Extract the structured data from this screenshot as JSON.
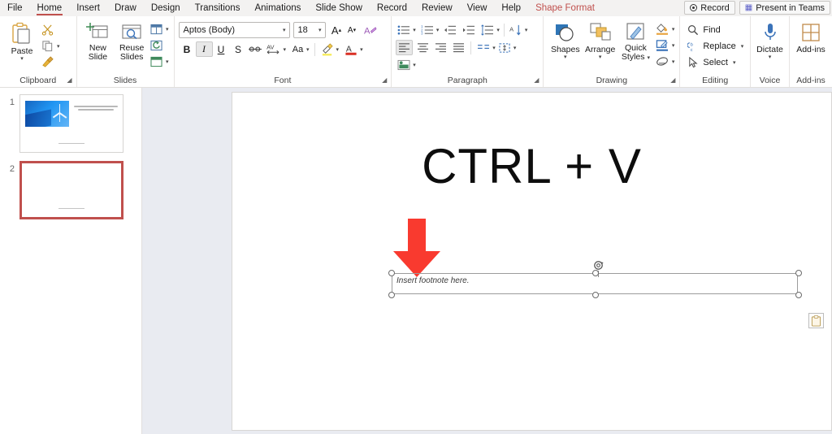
{
  "tabs": [
    {
      "label": "File",
      "state": "normal"
    },
    {
      "label": "Home",
      "state": "active"
    },
    {
      "label": "Insert",
      "state": "normal"
    },
    {
      "label": "Draw",
      "state": "normal"
    },
    {
      "label": "Design",
      "state": "normal"
    },
    {
      "label": "Transitions",
      "state": "normal"
    },
    {
      "label": "Animations",
      "state": "normal"
    },
    {
      "label": "Slide Show",
      "state": "normal"
    },
    {
      "label": "Record",
      "state": "normal"
    },
    {
      "label": "Review",
      "state": "normal"
    },
    {
      "label": "View",
      "state": "normal"
    },
    {
      "label": "Help",
      "state": "normal"
    },
    {
      "label": "Shape Format",
      "state": "contextual"
    }
  ],
  "titlebar_right": {
    "record_label": "Record",
    "present_in_teams_label": "Present in Teams"
  },
  "ribbon": {
    "clipboard": {
      "group_label": "Clipboard",
      "paste_label": "Paste",
      "cut_name": "Cut",
      "copy_name": "Copy",
      "format_painter_name": "Format Painter"
    },
    "slides": {
      "group_label": "Slides",
      "new_slide_label": "New Slide",
      "reuse_slides_label": "Reuse Slides",
      "layout_name": "Layout",
      "reset_name": "Reset",
      "section_name": "Section"
    },
    "font": {
      "group_label": "Font",
      "font_name_value": "Aptos (Body)",
      "font_size_value": "18",
      "grow_font": "A",
      "shrink_font": "A",
      "clear_formatting": "A",
      "bold": "B",
      "italic": "I",
      "underline": "U",
      "strikethrough": "S",
      "shadow_name": "Text Shadow",
      "char_spacing": "AV",
      "change_case": "Aa",
      "highlight_name": "Text Highlight Color",
      "font_color": "A",
      "italic_state": "active"
    },
    "paragraph": {
      "group_label": "Paragraph",
      "bullets_name": "Bullets",
      "numbering_name": "Numbering",
      "decrease_indent_name": "Decrease Indent",
      "increase_indent_name": "Increase Indent",
      "line_spacing_name": "Line Spacing",
      "align_left_name": "Align Left",
      "center_name": "Center",
      "align_right_name": "Align Right",
      "justify_name": "Justify",
      "columns_name": "Columns",
      "text_direction_name": "Text Direction",
      "align_text_name": "Align Text",
      "convert_smartart_name": "Convert to SmartArt",
      "align_left_state": "active"
    },
    "drawing": {
      "group_label": "Drawing",
      "shapes_label": "Shapes",
      "arrange_label": "Arrange",
      "quick_styles_label": "Quick Styles",
      "shape_fill_name": "Shape Fill",
      "shape_outline_name": "Shape Outline",
      "shape_effects_name": "Shape Effects"
    },
    "editing": {
      "group_label": "Editing",
      "find_label": "Find",
      "replace_label": "Replace",
      "select_label": "Select"
    },
    "voice": {
      "group_label": "Voice",
      "dictate_label": "Dictate"
    },
    "addins": {
      "group_label": "Add-ins",
      "addins_label": "Add-ins"
    }
  },
  "thumbnails": [
    {
      "number": "1",
      "state": "normal",
      "has_image": true,
      "image_name": "solar-panels-wind-turbine-photo",
      "body_lines": 2
    },
    {
      "number": "2",
      "state": "selected",
      "has_image": false,
      "body_lines": 0
    }
  ],
  "slide": {
    "title_text": "CTRL + V",
    "arrow_name": "down-arrow-shape",
    "arrow_color": "#f93a2f",
    "textbox": {
      "text": "Insert footnote here.",
      "selected": true,
      "handle_count": 6
    },
    "paste_options_name": "paste-options-button"
  },
  "colors": {
    "accent": "#c0504d",
    "ribbon_bg": "#ffffff",
    "tabbar_bg": "#f3f2f1",
    "canvas_bg": "#e9ebf1",
    "arrow_red": "#f93a2f"
  }
}
